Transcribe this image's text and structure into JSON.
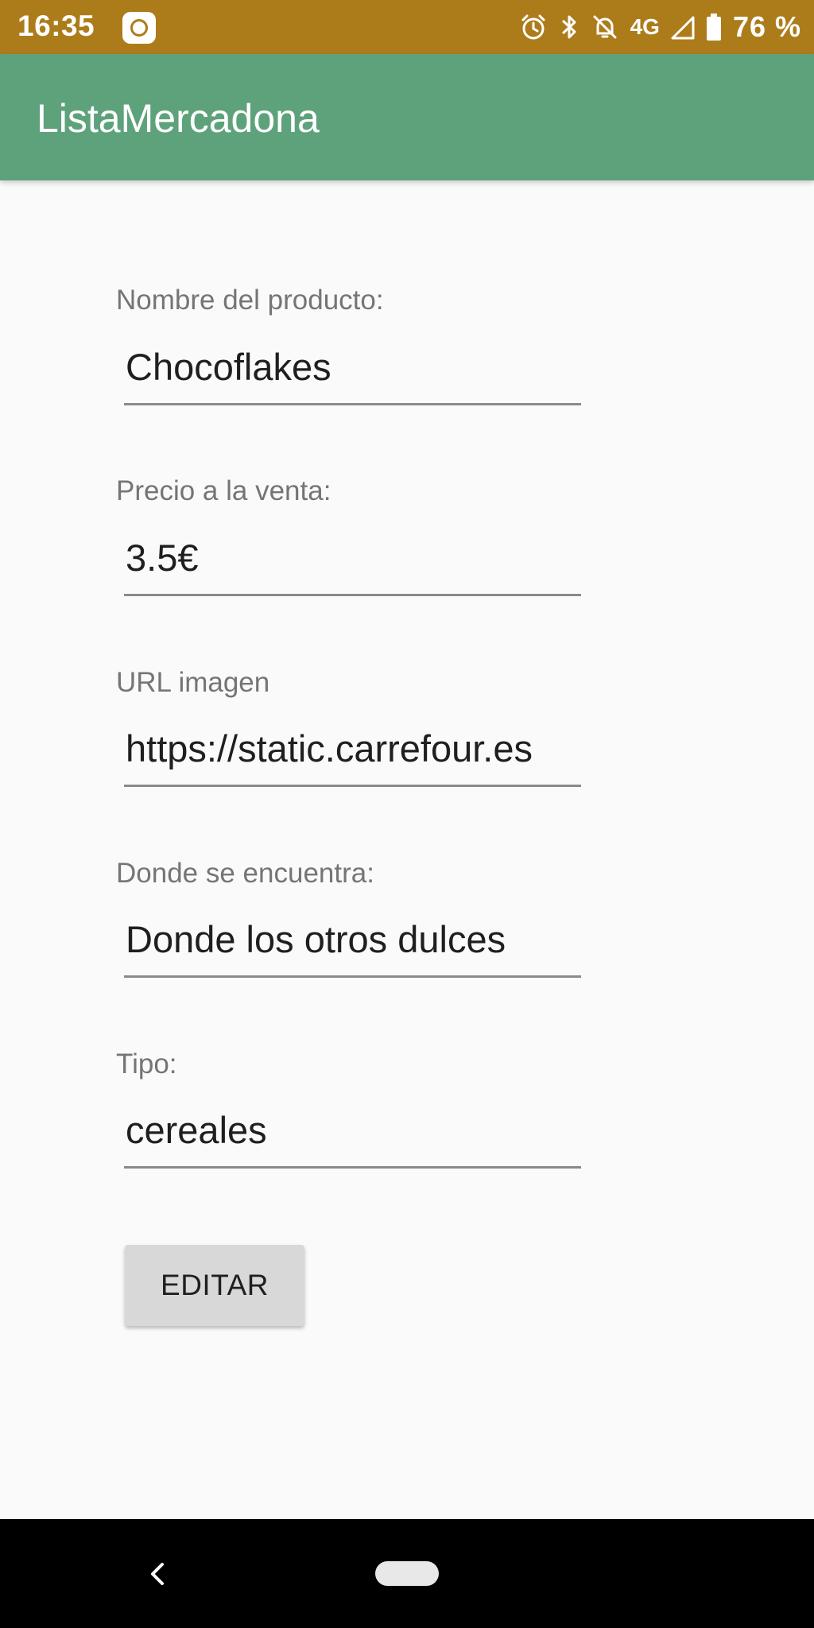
{
  "status_bar": {
    "time": "16:35",
    "network": "4G",
    "battery": "76 %",
    "icons": [
      "app-notification-icon",
      "alarm-icon",
      "bluetooth-icon",
      "notifications-off-icon",
      "signal-icon",
      "battery-icon"
    ]
  },
  "app_bar": {
    "title": "ListaMercadona",
    "color": "#5ea27c"
  },
  "form": {
    "nombre": {
      "label": "Nombre del producto:",
      "value": "Chocoflakes"
    },
    "precio": {
      "label": "Precio a la venta:",
      "value": "3.5€"
    },
    "url": {
      "label": "URL imagen",
      "value": "https://static.carrefour.es"
    },
    "donde": {
      "label": "Donde se encuentra:",
      "value": "Donde los otros dulces"
    },
    "tipo": {
      "label": "Tipo:",
      "value": "cereales"
    }
  },
  "edit_button": {
    "label": "EDITAR"
  },
  "colors": {
    "status_bar": "#ad7c1a",
    "app_bar": "#5ea27c",
    "background": "#fafafa",
    "button": "#d8d8d8"
  },
  "nav_bar": {
    "icons": [
      "back-icon",
      "home-pill-icon"
    ]
  }
}
